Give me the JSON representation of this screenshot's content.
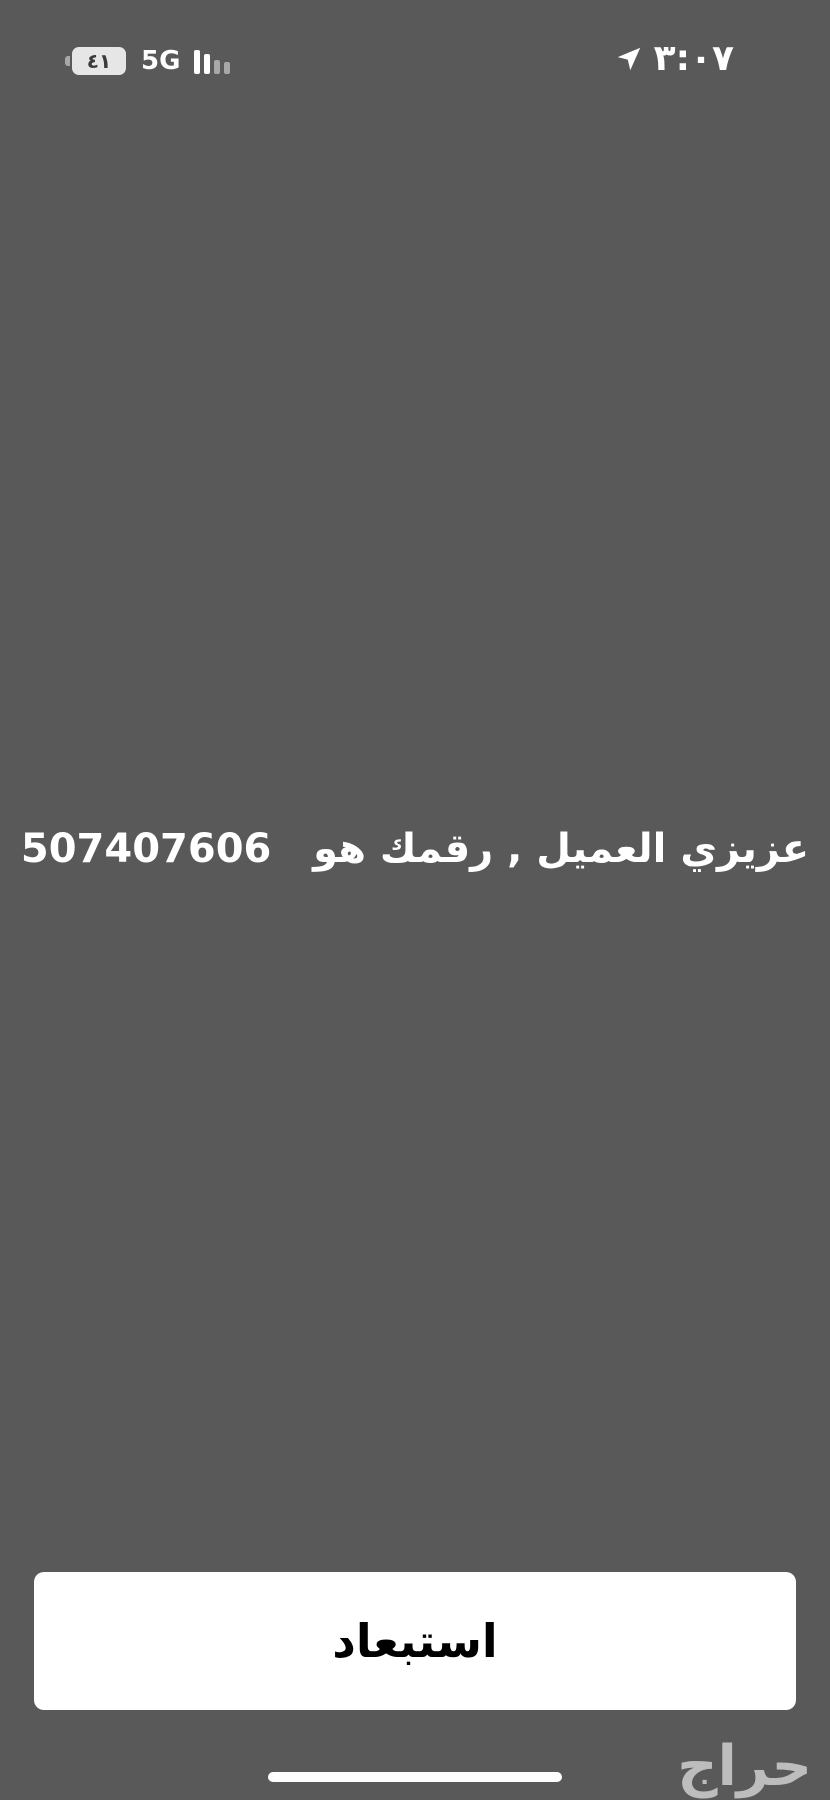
{
  "status_bar": {
    "time": "٣:٠٧",
    "network": "5G",
    "battery_level": "٤١",
    "location_icon": "location-arrow-icon",
    "signal_icon": "cellular-signal-icon",
    "signal_bars_active": 2,
    "signal_bars_total": 4
  },
  "message": {
    "prefix": "عزيزي العميل , رقمك هو",
    "number": "507407606"
  },
  "dismiss_button": {
    "label": "استبعاد"
  },
  "watermark": {
    "text": "حراج"
  },
  "colors": {
    "background": "#595959",
    "button_background": "#ffffff",
    "text": "#ffffff",
    "button_text": "#000000"
  }
}
